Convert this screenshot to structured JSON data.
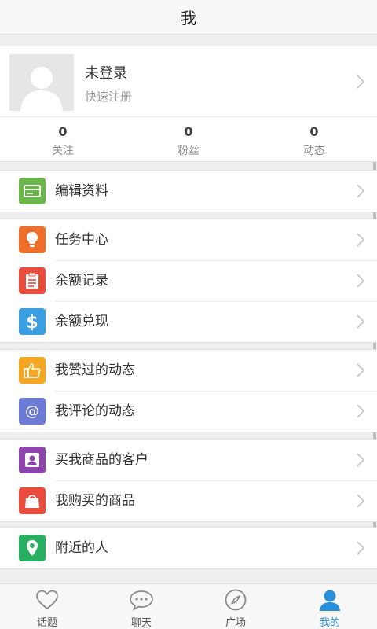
{
  "header": {
    "title": "我"
  },
  "profile": {
    "name": "未登录",
    "subtitle": "快速注册"
  },
  "stats": [
    {
      "value": "0",
      "label": "关注"
    },
    {
      "value": "0",
      "label": "粉丝"
    },
    {
      "value": "0",
      "label": "动态"
    }
  ],
  "menu": {
    "edit_profile": {
      "label": "编辑资料",
      "icon": "card-icon",
      "color": "#6bb64a"
    },
    "task_center": {
      "label": "任务中心",
      "icon": "lightbulb-icon",
      "color": "#ee6f2c"
    },
    "balance_record": {
      "label": "余额记录",
      "icon": "clipboard-icon",
      "color": "#e84c3d"
    },
    "balance_withdraw": {
      "label": "余额兑现",
      "icon": "dollar-icon",
      "color": "#3b9ee0"
    },
    "liked_posts": {
      "label": "我赞过的动态",
      "icon": "thumbs-up-icon",
      "color": "#f5a623"
    },
    "commented_posts": {
      "label": "我评论的动态",
      "icon": "at-icon",
      "color": "#6c7bd6"
    },
    "customers": {
      "label": "买我商品的客户",
      "icon": "person-icon",
      "color": "#8e44ad"
    },
    "purchases": {
      "label": "我购买的商品",
      "icon": "bag-icon",
      "color": "#e84c3d"
    },
    "nearby": {
      "label": "附近的人",
      "icon": "location-icon",
      "color": "#27ae60"
    }
  },
  "tabs": [
    {
      "label": "话题",
      "icon": "heart-icon"
    },
    {
      "label": "聊天",
      "icon": "chat-bubble-icon"
    },
    {
      "label": "广场",
      "icon": "compass-icon"
    },
    {
      "label": "我的",
      "icon": "user-icon",
      "active": true,
      "color": "#2a8fd9"
    }
  ]
}
